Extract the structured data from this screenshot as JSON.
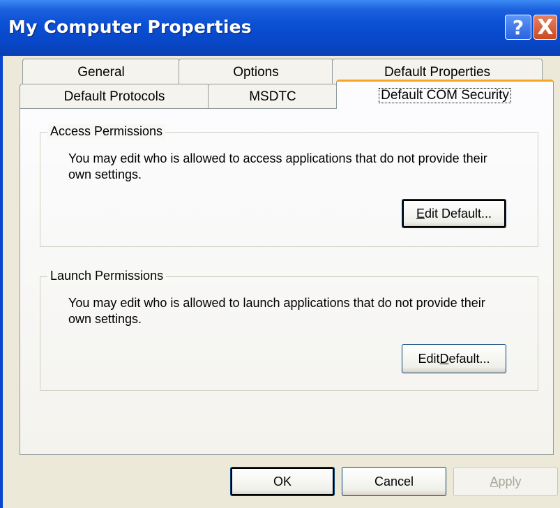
{
  "window": {
    "title": "My Computer Properties"
  },
  "titlebar_buttons": {
    "help": "?",
    "close": "X"
  },
  "tabs": {
    "row1": [
      {
        "label": "General"
      },
      {
        "label": "Options"
      },
      {
        "label": "Default Properties"
      }
    ],
    "row2": [
      {
        "label": "Default Protocols"
      },
      {
        "label": "MSDTC"
      },
      {
        "label": "Default COM Security",
        "active": true
      }
    ]
  },
  "access": {
    "title": "Access Permissions",
    "description": "You may edit who is allowed to access applications that do not provide their own settings.",
    "button": {
      "prefix": "",
      "mnemonic": "E",
      "rest": "dit Default..."
    }
  },
  "launch": {
    "title": "Launch Permissions",
    "description": "You may edit who is allowed to launch applications that do not provide their own settings.",
    "button": {
      "prefix": "Edit ",
      "mnemonic": "D",
      "rest": "efault..."
    }
  },
  "footer": {
    "ok": "OK",
    "cancel": "Cancel",
    "apply": {
      "mnemonic": "A",
      "rest": "pply"
    }
  },
  "colors": {
    "titlebar": "#0a4fd4",
    "dialog": "#ece9d8",
    "active_tab_accent": "#f5a623"
  }
}
